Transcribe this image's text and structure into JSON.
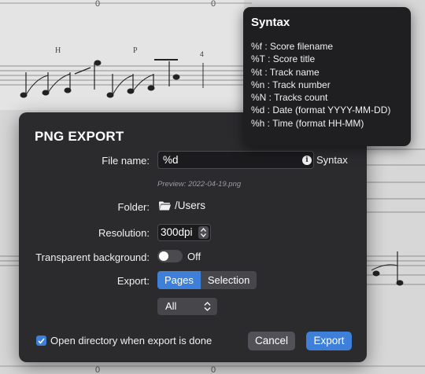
{
  "score": {
    "labels": [
      "0",
      "0",
      "H",
      "P",
      "4",
      "0",
      "0"
    ]
  },
  "dialog": {
    "title": "PNG EXPORT",
    "file_name_label": "File name:",
    "file_name_value": "%d",
    "syntax_label": "Syntax",
    "preview": "Preview: 2022-04-19.png",
    "folder_label": "Folder:",
    "folder_value": "/Users",
    "resolution_label": "Resolution:",
    "resolution_value": "300dpi",
    "transparent_label": "Transparent background:",
    "transparent_state": "Off",
    "transparent_on": false,
    "export_label": "Export:",
    "export_options": [
      "Pages",
      "Selection"
    ],
    "export_selected": "Pages",
    "pages_select_value": "All",
    "open_dir_label": "Open directory when export is done",
    "open_dir_checked": true,
    "cancel_label": "Cancel",
    "export_button_label": "Export"
  },
  "tooltip": {
    "title": "Syntax",
    "items": [
      "%f : Score filename",
      "%T : Score title",
      "%t : Track name",
      "%n : Track number",
      "%N : Tracks count",
      "%d : Date (format YYYY-MM-DD)",
      "%h : Time (format HH-MM)"
    ]
  },
  "colors": {
    "accent": "#3d7fd9",
    "dialog_bg": "#2b2b2e",
    "tooltip_bg": "#1f1f21"
  }
}
